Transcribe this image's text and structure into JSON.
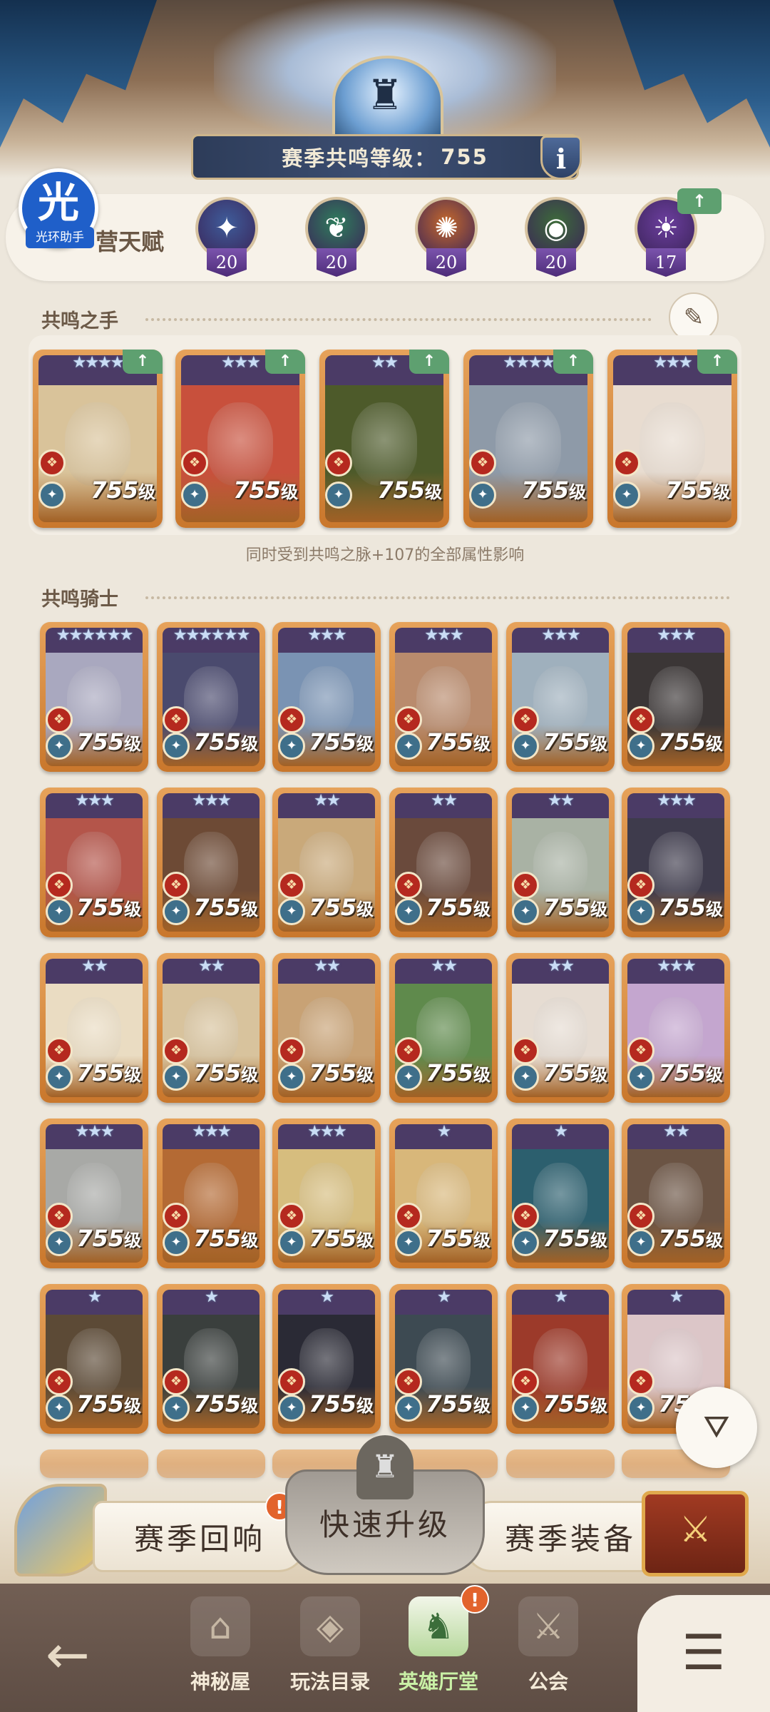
{
  "header": {
    "level_label": "赛季共鸣等级：",
    "level_value": "755",
    "info_label": "i"
  },
  "logo": {
    "glyph": "光",
    "label": "光环助手"
  },
  "talent": {
    "title": "营天赋",
    "factions": [
      {
        "icon": "star-compass-icon",
        "glyph": "✦",
        "level": "20",
        "color": "#3e5c9a"
      },
      {
        "icon": "leaf-icon",
        "glyph": "❦",
        "level": "20",
        "color": "#2f7d5c"
      },
      {
        "icon": "sun-icon",
        "glyph": "✺",
        "level": "20",
        "color": "#c4682c"
      },
      {
        "icon": "eye-icon",
        "glyph": "◉",
        "level": "20",
        "color": "#3d6b3a"
      },
      {
        "icon": "celestial-icon",
        "glyph": "☀",
        "level": "17",
        "color": "#6b3e9e"
      }
    ],
    "upgrade_arrow": "↑"
  },
  "hand_section": {
    "title": "共鸣之手",
    "note": "同时受到共鸣之脉+107的全部属性影响",
    "heroes": [
      {
        "stars": "★★★★",
        "level": "755",
        "unit": "级",
        "bg": "#d9c39a"
      },
      {
        "stars": "★★★",
        "level": "755",
        "unit": "级",
        "bg": "#c8503c"
      },
      {
        "stars": "★★",
        "level": "755",
        "unit": "级",
        "bg": "#4d5a2a"
      },
      {
        "stars": "★★★★",
        "level": "755",
        "unit": "级",
        "bg": "#8e9aa8"
      },
      {
        "stars": "★★★",
        "level": "755",
        "unit": "级",
        "bg": "#e8dcd0"
      }
    ]
  },
  "knight_section": {
    "title": "共鸣骑士",
    "heroes": [
      {
        "stars": "★★★★★★",
        "level": "755",
        "unit": "级",
        "bg": "#a9a8bf"
      },
      {
        "stars": "★★★★★★",
        "level": "755",
        "unit": "级",
        "bg": "#4a4a6e"
      },
      {
        "stars": "★★★",
        "level": "755",
        "unit": "级",
        "bg": "#7a93b3"
      },
      {
        "stars": "★★★",
        "level": "755",
        "unit": "级",
        "bg": "#b98b6d"
      },
      {
        "stars": "★★★",
        "level": "755",
        "unit": "级",
        "bg": "#9fb0bd"
      },
      {
        "stars": "★★★",
        "level": "755",
        "unit": "级",
        "bg": "#3b3636"
      },
      {
        "stars": "★★★",
        "level": "755",
        "unit": "级",
        "bg": "#b4554a"
      },
      {
        "stars": "★★★",
        "level": "755",
        "unit": "级",
        "bg": "#6d4a35"
      },
      {
        "stars": "★★",
        "level": "755",
        "unit": "级",
        "bg": "#c9a97a"
      },
      {
        "stars": "★★",
        "level": "755",
        "unit": "级",
        "bg": "#6a4a3c"
      },
      {
        "stars": "★★",
        "level": "755",
        "unit": "级",
        "bg": "#a9b2a4"
      },
      {
        "stars": "★★★",
        "level": "755",
        "unit": "级",
        "bg": "#3e3b4c"
      },
      {
        "stars": "★★",
        "level": "755",
        "unit": "级",
        "bg": "#eadcc2"
      },
      {
        "stars": "★★",
        "level": "755",
        "unit": "级",
        "bg": "#d8c39d"
      },
      {
        "stars": "★★",
        "level": "755",
        "unit": "级",
        "bg": "#c8a275"
      },
      {
        "stars": "★★",
        "level": "755",
        "unit": "级",
        "bg": "#5f8a4c"
      },
      {
        "stars": "★★",
        "level": "755",
        "unit": "级",
        "bg": "#e6dcd2"
      },
      {
        "stars": "★★★",
        "level": "755",
        "unit": "级",
        "bg": "#c4a6cf"
      },
      {
        "stars": "★★★",
        "level": "755",
        "unit": "级",
        "bg": "#a8a9a6"
      },
      {
        "stars": "★★★",
        "level": "755",
        "unit": "级",
        "bg": "#b46a34"
      },
      {
        "stars": "★★★",
        "level": "755",
        "unit": "级",
        "bg": "#d6bd7e"
      },
      {
        "stars": "★",
        "level": "755",
        "unit": "级",
        "bg": "#d8b77a"
      },
      {
        "stars": "★",
        "level": "755",
        "unit": "级",
        "bg": "#2c5f6e"
      },
      {
        "stars": "★★",
        "level": "755",
        "unit": "级",
        "bg": "#6b5444"
      },
      {
        "stars": "★",
        "level": "755",
        "unit": "级",
        "bg": "#5c4a36"
      },
      {
        "stars": "★",
        "level": "755",
        "unit": "级",
        "bg": "#3a3f3d"
      },
      {
        "stars": "★",
        "level": "755",
        "unit": "级",
        "bg": "#2a2a35"
      },
      {
        "stars": "★",
        "level": "755",
        "unit": "级",
        "bg": "#3d4a52"
      },
      {
        "stars": "★",
        "level": "755",
        "unit": "级",
        "bg": "#9c3a2a"
      },
      {
        "stars": "★",
        "level": "755",
        "unit": "级",
        "bg": "#dcc6c8"
      }
    ]
  },
  "action_bar": {
    "left_label": "赛季回响",
    "center_label": "快速升级",
    "right_label": "赛季装备",
    "alert": "!"
  },
  "nav": {
    "back_glyph": "←",
    "items": [
      {
        "label": "神秘屋",
        "icon": "mystery-house-icon",
        "glyph": "⌂"
      },
      {
        "label": "玩法目录",
        "icon": "catalog-icon",
        "glyph": "◈"
      },
      {
        "label": "英雄厅堂",
        "icon": "hero-hall-icon",
        "glyph": "♞"
      },
      {
        "label": "公会",
        "icon": "guild-icon",
        "glyph": "⚔"
      }
    ],
    "menu_glyph": "☰",
    "alert": "!"
  },
  "filter_glyph": "⛛"
}
